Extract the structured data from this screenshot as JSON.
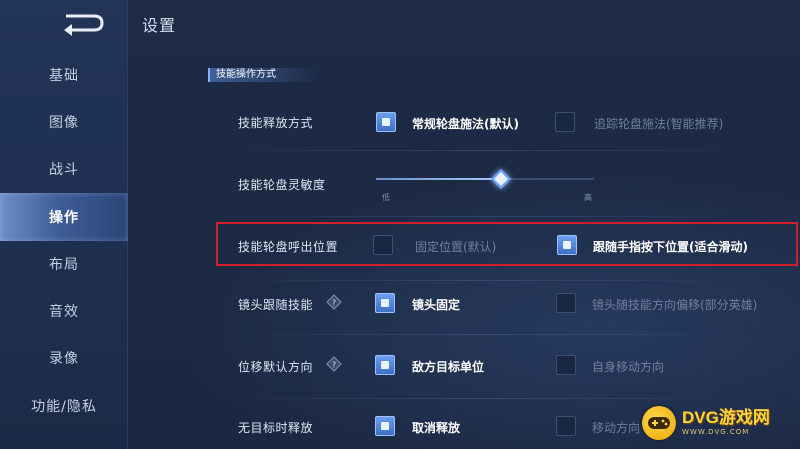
{
  "header": {
    "title": "设置"
  },
  "sidebar": {
    "items": [
      {
        "label": "基础"
      },
      {
        "label": "图像"
      },
      {
        "label": "战斗"
      },
      {
        "label": "操作",
        "active": true
      },
      {
        "label": "布局"
      },
      {
        "label": "音效"
      },
      {
        "label": "录像"
      },
      {
        "label": "功能/隐私"
      }
    ]
  },
  "section": {
    "title": "技能操作方式"
  },
  "settings": {
    "release_mode": {
      "label": "技能释放方式",
      "option1": {
        "label": "常规轮盘施法(默认)",
        "checked": true
      },
      "option2": {
        "label": "追踪轮盘施法(智能推荐)",
        "checked": false
      }
    },
    "sensitivity": {
      "label": "技能轮盘灵敏度",
      "low_label": "低",
      "high_label": "高",
      "value": 0.55
    },
    "popup_position": {
      "label": "技能轮盘呼出位置",
      "option1": {
        "label": "固定位置(默认)",
        "checked": false
      },
      "option2": {
        "label": "跟随手指按下位置(适合滑动)",
        "checked": true
      }
    },
    "camera_follow": {
      "label": "镜头跟随技能",
      "option1": {
        "label": "镜头固定",
        "checked": true
      },
      "option2": {
        "label": "镜头随技能方向偏移(部分英雄)",
        "checked": false
      }
    },
    "move_direction": {
      "label": "位移默认方向",
      "option1": {
        "label": "敌方目标单位",
        "checked": true
      },
      "option2": {
        "label": "自身移动方向",
        "checked": false
      }
    },
    "no_target": {
      "label": "无目标时释放",
      "option1": {
        "label": "取消释放",
        "checked": true
      },
      "option2": {
        "label": "移动方向",
        "checked": false
      }
    }
  },
  "watermark": {
    "title": "DVG游戏网",
    "url": "WWW.DVG.COM"
  },
  "colors": {
    "accent": "#5f94ec",
    "highlight_border": "#d21d2a",
    "active_nav": "#4a6ba8"
  }
}
